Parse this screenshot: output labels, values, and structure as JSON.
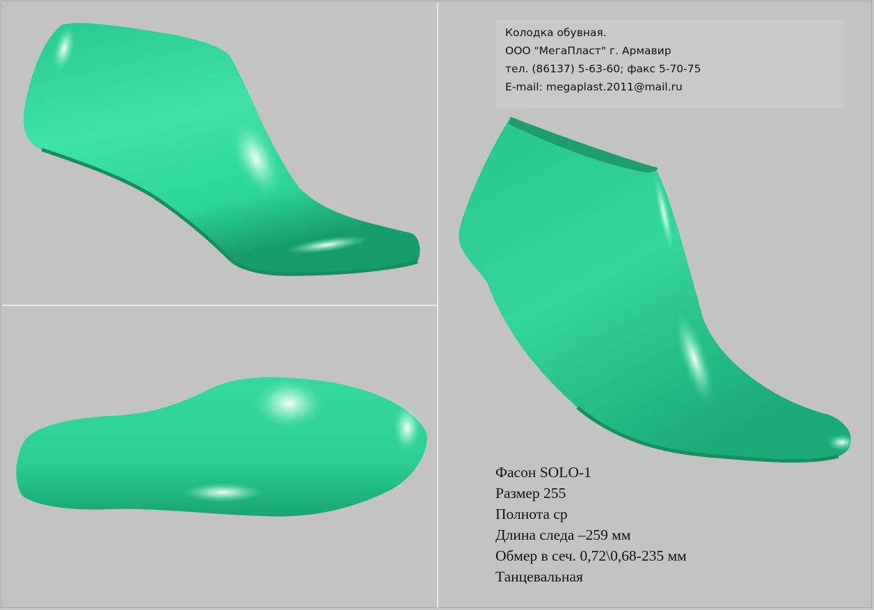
{
  "colors": {
    "background": "#c3c3c3",
    "model_green": "#2fd69a",
    "model_green_dark": "#18a876",
    "highlight": "#f4fffb"
  },
  "contact": {
    "lines": [
      "Колодка обувная.",
      "ООО \"МегаПласт\" г. Армавир",
      "тел. (86137) 5-63-60; факс 5-70-75",
      "E-mail: megaplast.2011@mail.ru"
    ]
  },
  "specs": {
    "lines": [
      "Фасон SOLO-1",
      "Размер 255",
      "Полнота ср",
      "Длина следа –259 мм",
      "Обмер в сеч. 0,72\\0,68-235 мм",
      "Танцевальная"
    ]
  }
}
